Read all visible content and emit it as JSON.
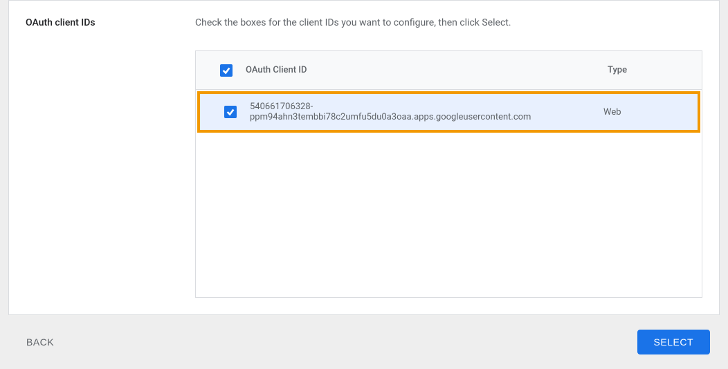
{
  "section": {
    "label": "OAuth client IDs",
    "instruction": "Check the boxes for the client IDs you want to configure, then click Select."
  },
  "table": {
    "headers": {
      "id": "OAuth Client ID",
      "type": "Type"
    },
    "rows": [
      {
        "id": "540661706328-ppm94ahn3tembbi78c2umfu5du0a3oaa.apps.googleusercontent.com",
        "type": "Web",
        "checked": true
      }
    ]
  },
  "footer": {
    "back": "Back",
    "select": "Select"
  }
}
